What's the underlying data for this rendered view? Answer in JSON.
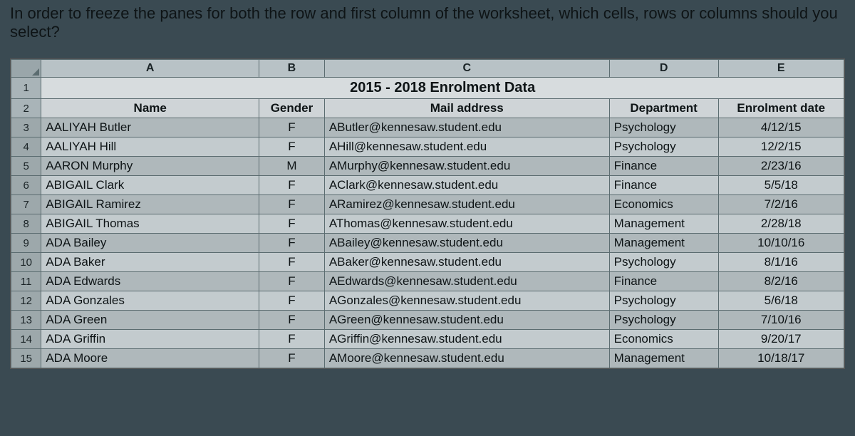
{
  "question": "In order to freeze the panes for both the row and first column of the worksheet, which cells, rows or columns should you select?",
  "columns": [
    "A",
    "B",
    "C",
    "D",
    "E"
  ],
  "title": "2015 - 2018 Enrolment Data",
  "headers": {
    "name": "Name",
    "gender": "Gender",
    "mail": "Mail address",
    "dept": "Department",
    "enrol": "Enrolment date"
  },
  "rows": [
    {
      "num": "3",
      "name": "AALIYAH Butler",
      "gender": "F",
      "mail": "AButler@kennesaw.student.edu",
      "dept": "Psychology",
      "enrol": "4/12/15"
    },
    {
      "num": "4",
      "name": "AALIYAH Hill",
      "gender": "F",
      "mail": "AHill@kennesaw.student.edu",
      "dept": "Psychology",
      "enrol": "12/2/15"
    },
    {
      "num": "5",
      "name": "AARON Murphy",
      "gender": "M",
      "mail": "AMurphy@kennesaw.student.edu",
      "dept": "Finance",
      "enrol": "2/23/16"
    },
    {
      "num": "6",
      "name": "ABIGAIL Clark",
      "gender": "F",
      "mail": "AClark@kennesaw.student.edu",
      "dept": "Finance",
      "enrol": "5/5/18"
    },
    {
      "num": "7",
      "name": "ABIGAIL Ramirez",
      "gender": "F",
      "mail": "ARamirez@kennesaw.student.edu",
      "dept": "Economics",
      "enrol": "7/2/16"
    },
    {
      "num": "8",
      "name": "ABIGAIL Thomas",
      "gender": "F",
      "mail": "AThomas@kennesaw.student.edu",
      "dept": "Management",
      "enrol": "2/28/18"
    },
    {
      "num": "9",
      "name": "ADA Bailey",
      "gender": "F",
      "mail": "ABailey@kennesaw.student.edu",
      "dept": "Management",
      "enrol": "10/10/16"
    },
    {
      "num": "10",
      "name": "ADA Baker",
      "gender": "F",
      "mail": "ABaker@kennesaw.student.edu",
      "dept": "Psychology",
      "enrol": "8/1/16"
    },
    {
      "num": "11",
      "name": "ADA Edwards",
      "gender": "F",
      "mail": "AEdwards@kennesaw.student.edu",
      "dept": "Finance",
      "enrol": "8/2/16"
    },
    {
      "num": "12",
      "name": "ADA Gonzales",
      "gender": "F",
      "mail": "AGonzales@kennesaw.student.edu",
      "dept": "Psychology",
      "enrol": "5/6/18"
    },
    {
      "num": "13",
      "name": "ADA Green",
      "gender": "F",
      "mail": "AGreen@kennesaw.student.edu",
      "dept": "Psychology",
      "enrol": "7/10/16"
    },
    {
      "num": "14",
      "name": "ADA Griffin",
      "gender": "F",
      "mail": "AGriffin@kennesaw.student.edu",
      "dept": "Economics",
      "enrol": "9/20/17"
    },
    {
      "num": "15",
      "name": "ADA Moore",
      "gender": "F",
      "mail": "AMoore@kennesaw.student.edu",
      "dept": "Management",
      "enrol": "10/18/17"
    }
  ],
  "row1": "1",
  "row2": "2"
}
